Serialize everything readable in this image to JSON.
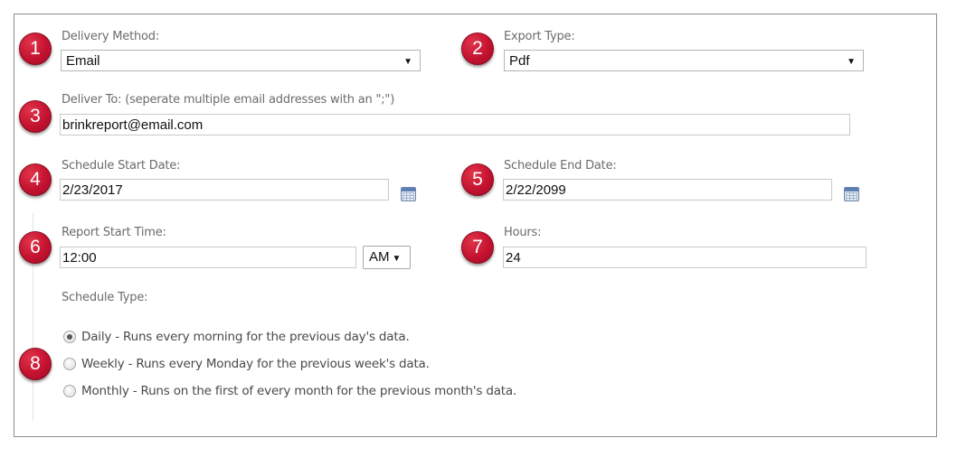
{
  "badges": [
    "1",
    "2",
    "3",
    "4",
    "5",
    "6",
    "7",
    "8"
  ],
  "delivery_method": {
    "label": "Delivery Method:",
    "value": "Email"
  },
  "export_type": {
    "label": "Export Type:",
    "value": "Pdf"
  },
  "deliver_to": {
    "label": "Deliver To: (seperate multiple email addresses with an \";\")",
    "value": "brinkreport@email.com"
  },
  "schedule_start_date": {
    "label": "Schedule Start Date:",
    "value": "2/23/2017"
  },
  "schedule_end_date": {
    "label": "Schedule End Date:",
    "value": "2/22/2099"
  },
  "report_start_time": {
    "label": "Report Start Time:",
    "value": "12:00",
    "ampm": "AM"
  },
  "hours": {
    "label": "Hours:",
    "value": "24"
  },
  "schedule_type": {
    "label": "Schedule Type:",
    "selected": "daily",
    "options": [
      {
        "id": "daily",
        "label": "Daily - Runs every morning for the previous day's data."
      },
      {
        "id": "weekly",
        "label": "Weekly - Runs every Monday for the previous week's data."
      },
      {
        "id": "monthly",
        "label": "Monthly - Runs on the first of every month for the previous month's data."
      }
    ]
  },
  "icons": {
    "dropdown": "caret-down-icon",
    "calendar": "calendar-icon"
  },
  "colors": {
    "badge": "#c41230",
    "border": "#8c8c8c",
    "label": "#6b6b6b"
  }
}
